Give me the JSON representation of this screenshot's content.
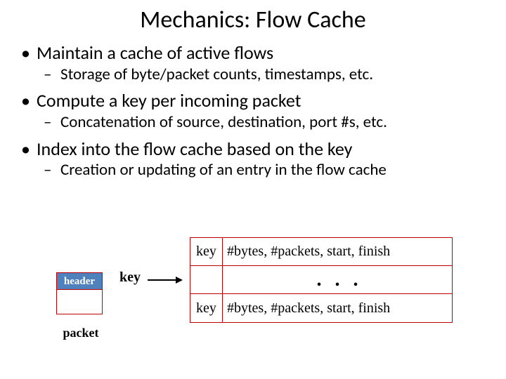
{
  "title": "Mechanics: Flow Cache",
  "bullets": {
    "b1": "Maintain a cache of active flows",
    "b1a": "Storage of byte/packet counts, timestamps, etc.",
    "b2": "Compute a key per incoming packet",
    "b2a": "Concatenation of source, destination, port #s, etc.",
    "b3": "Index into the flow cache based on the key",
    "b3a": "Creation or updating of an entry in the flow cache"
  },
  "diagram": {
    "packet_header": "header",
    "packet_label": "packet",
    "key_label": "key",
    "row_key": "key",
    "row_val": "#bytes, #packets, start, finish",
    "dots": ". . ."
  }
}
